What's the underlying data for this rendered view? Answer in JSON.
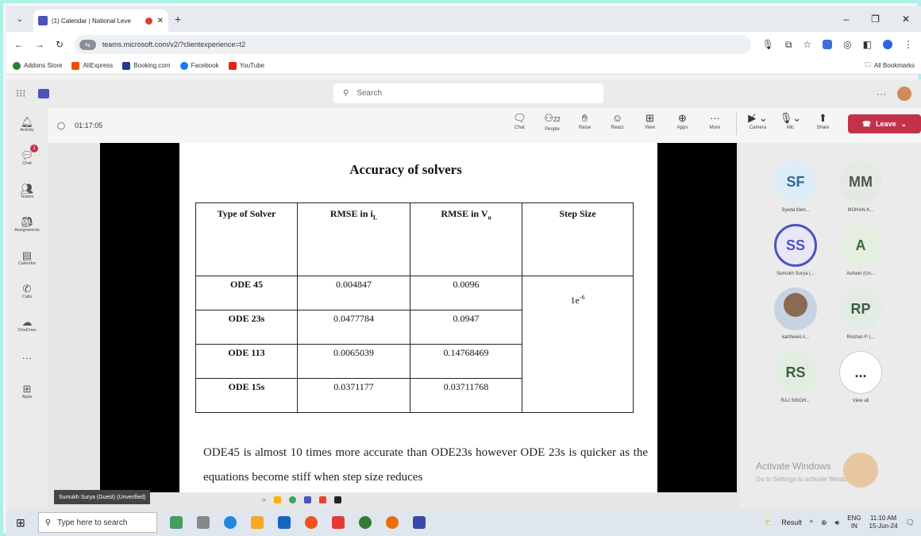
{
  "browser": {
    "tab_title": "(1) Calendar | National Leve",
    "url": "teams.microsoft.com/v2/?clientexperience=t2",
    "bookmarks": [
      "Addons Store",
      "AliExpress",
      "Booking.com",
      "Facebook",
      "YouTube"
    ],
    "all_bookmarks": "All Bookmarks"
  },
  "teams": {
    "search_placeholder": "Search",
    "rail": [
      "Activity",
      "Chat",
      "Teams",
      "Assignments",
      "Calendar",
      "Calls",
      "OneDrive",
      "Apps"
    ],
    "chat_badge": "1"
  },
  "meeting": {
    "timer": "01:17:05",
    "tools": [
      {
        "icon": "chat-icon",
        "label": "Chat"
      },
      {
        "icon": "people-icon",
        "label": "People"
      },
      {
        "icon": "raise-hand-icon",
        "label": "Raise"
      },
      {
        "icon": "react-icon",
        "label": "React"
      },
      {
        "icon": "view-icon",
        "label": "View"
      },
      {
        "icon": "apps-icon",
        "label": "Apps"
      },
      {
        "icon": "more-icon",
        "label": "More"
      }
    ],
    "people_count": "22",
    "media": [
      {
        "icon": "camera-icon",
        "label": "Camera"
      },
      {
        "icon": "mic-icon",
        "label": "Mic"
      },
      {
        "icon": "share-icon",
        "label": "Share"
      }
    ],
    "leave_label": "Leave"
  },
  "slide": {
    "title": "Accuracy of solvers",
    "headers": [
      "Type of Solver",
      "RMSE in i",
      "RMSE in V",
      "Step Size"
    ],
    "header_subs": [
      "",
      "L",
      "o",
      ""
    ],
    "rows": [
      [
        "ODE 45",
        "0.004847",
        "0.0096"
      ],
      [
        "ODE 23s",
        "0.0477784",
        "0.0947"
      ],
      [
        "ODE 113",
        "0.0065039",
        "0.14768469"
      ],
      [
        "ODE 15s",
        "0.0371177",
        "0.03711768"
      ]
    ],
    "step_size": "1e",
    "step_size_exp": "-6",
    "paragraph": "ODE45 is almost 10 times more accurate than ODE23s however ODE 23s is quicker as the equations become stiff when step size reduces"
  },
  "presenter_caption": "Sumukh Surya (Guest) (Unverified)",
  "participants": [
    {
      "initials": "SF",
      "name": "Syeda Meh...",
      "bg": "#dcedf7",
      "fg": "#2b6c96"
    },
    {
      "initials": "MM",
      "name": "MOHAN K...",
      "bg": "#e4e9e4",
      "fg": "#4a5a4a"
    },
    {
      "initials": "SS",
      "name": "Sumukh Surya (...",
      "bg": "#e9e6f7",
      "fg": "#4b53bc"
    },
    {
      "initials": "A",
      "name": "Ashwin (Un...",
      "bg": "#e4efe0",
      "fg": "#3e6a3a"
    },
    {
      "initials": "",
      "name": "kartheeki.n...",
      "bg": "#c7d3e2",
      "fg": "#333"
    },
    {
      "initials": "RP",
      "name": "Roshan P (...",
      "bg": "#e3ece4",
      "fg": "#3e5e44"
    },
    {
      "initials": "RS",
      "name": "RAJ SINGH...",
      "bg": "#e2ede2",
      "fg": "#3b5f3b"
    },
    {
      "initials": "...",
      "name": "View all",
      "bg": "#ffffff",
      "fg": "#333"
    }
  ],
  "watermark": {
    "title": "Activate Windows",
    "subtitle": "Go to Settings to activate Windows."
  },
  "taskbar": {
    "search_placeholder": "Type here to search",
    "result": "Result",
    "lang": "ENG",
    "region": "IN",
    "time": "11:10 AM",
    "date": "15-Jun-24"
  }
}
